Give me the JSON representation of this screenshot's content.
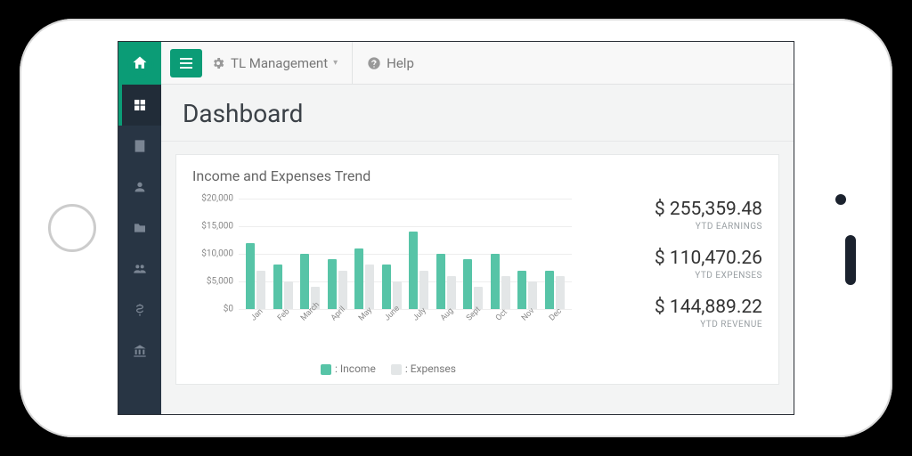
{
  "brand": {
    "letters": "TL",
    "accent": "#0b9c76"
  },
  "top": {
    "management_label": "TL Management",
    "help_label": "Help"
  },
  "page_title": "Dashboard",
  "sidebar_items": [
    {
      "name": "dashboard",
      "active": true
    },
    {
      "name": "building"
    },
    {
      "name": "user"
    },
    {
      "name": "folder"
    },
    {
      "name": "group"
    },
    {
      "name": "money"
    },
    {
      "name": "bank"
    }
  ],
  "card": {
    "title": "Income and Expenses Trend"
  },
  "legend": {
    "income": ": Income",
    "expenses": ": Expenses"
  },
  "stats": {
    "earnings": {
      "value": "$ 255,359.48",
      "label": "YTD EARNINGS"
    },
    "expenses": {
      "value": "$ 110,470.26",
      "label": "YTD EXPENSES"
    },
    "revenue": {
      "value": "$ 144,889.22",
      "label": "YTD REVENUE"
    }
  },
  "chart_data": {
    "type": "bar",
    "title": "Income and Expenses Trend",
    "ylabel": "",
    "xlabel": "",
    "ylim": [
      0,
      20000
    ],
    "yticks": [
      0,
      5000,
      10000,
      15000,
      20000
    ],
    "ytick_labels": [
      "$0",
      "$5,000",
      "$10,000",
      "$15,000",
      "$20,000"
    ],
    "categories": [
      "Jan",
      "Feb",
      "March",
      "April",
      "May",
      "June",
      "July",
      "Aug",
      "Sept",
      "Oct",
      "Nov",
      "Dec"
    ],
    "series": [
      {
        "name": "Income",
        "color": "#57c4a7",
        "values": [
          12000,
          8000,
          10000,
          9000,
          11000,
          8000,
          14000,
          10000,
          9000,
          10000,
          7000,
          7000
        ]
      },
      {
        "name": "Expenses",
        "color": "#e3e6e7",
        "values": [
          7000,
          5000,
          4000,
          7000,
          8000,
          5000,
          7000,
          6000,
          4000,
          6000,
          5000,
          6000
        ]
      }
    ]
  }
}
